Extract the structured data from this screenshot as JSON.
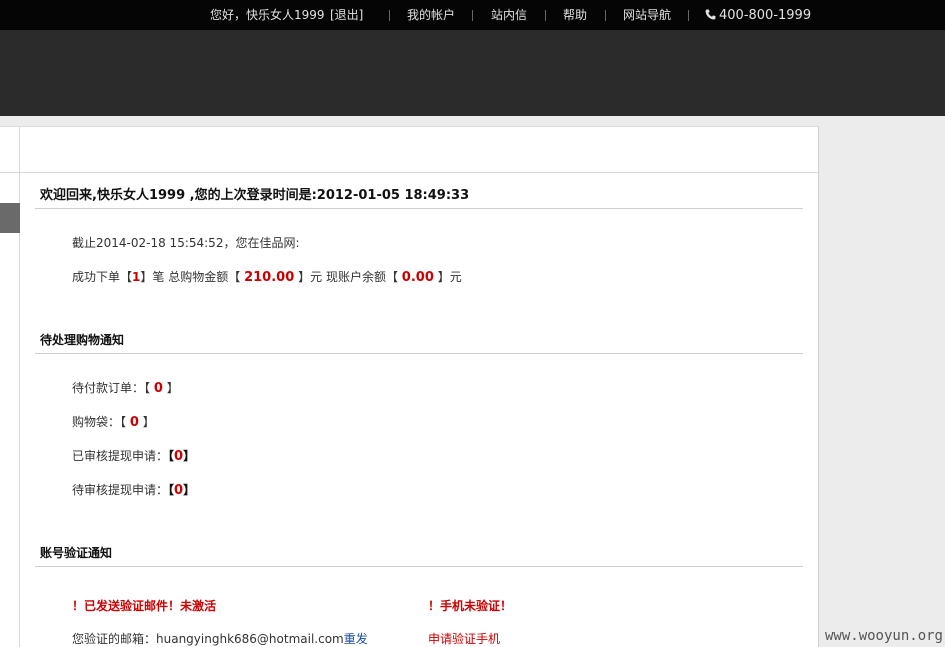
{
  "topbar": {
    "greeting": "您好，快乐女人1999",
    "logout": "[退出]",
    "my_account": "我的帐户",
    "messages": "站内信",
    "help": "帮助",
    "site_nav": "网站导航",
    "phone": "400-800-1999"
  },
  "welcome": {
    "text": "欢迎回来,快乐女人1999 ,您的上次登录时间是:2012-01-05 18:49:33"
  },
  "summary": {
    "line1": "截止2014-02-18 15:54:52，您在佳品网:",
    "orders_prefix": "成功下单",
    "order_count": "1",
    "orders_mid": "笔 总购物金额",
    "total_amount": "210.00",
    "unit_yuan": "元",
    "balance_label": "现账户余额",
    "balance": "0.00",
    "lb": "【",
    "rb": "】"
  },
  "pending": {
    "title": "待处理购物通知",
    "unpaid_label": "待付款订单：",
    "unpaid_count": "0",
    "cart_label": "购物袋：",
    "cart_count": "0",
    "approved_label": "已审核提现申请：",
    "approved_count": "0",
    "review_label": "待审核提现申请：",
    "review_count": "0"
  },
  "verify": {
    "title": "账号验证通知",
    "email_warn": "！已发送验证邮件！未激活",
    "phone_warn": "！手机未验证！",
    "email_prefix": "您验证的邮箱：",
    "email": "huangyinghk686@hotmail.com",
    "resend": "重发",
    "apply_phone": "申请验证手机"
  },
  "watermark": "www.wooyun.org"
}
